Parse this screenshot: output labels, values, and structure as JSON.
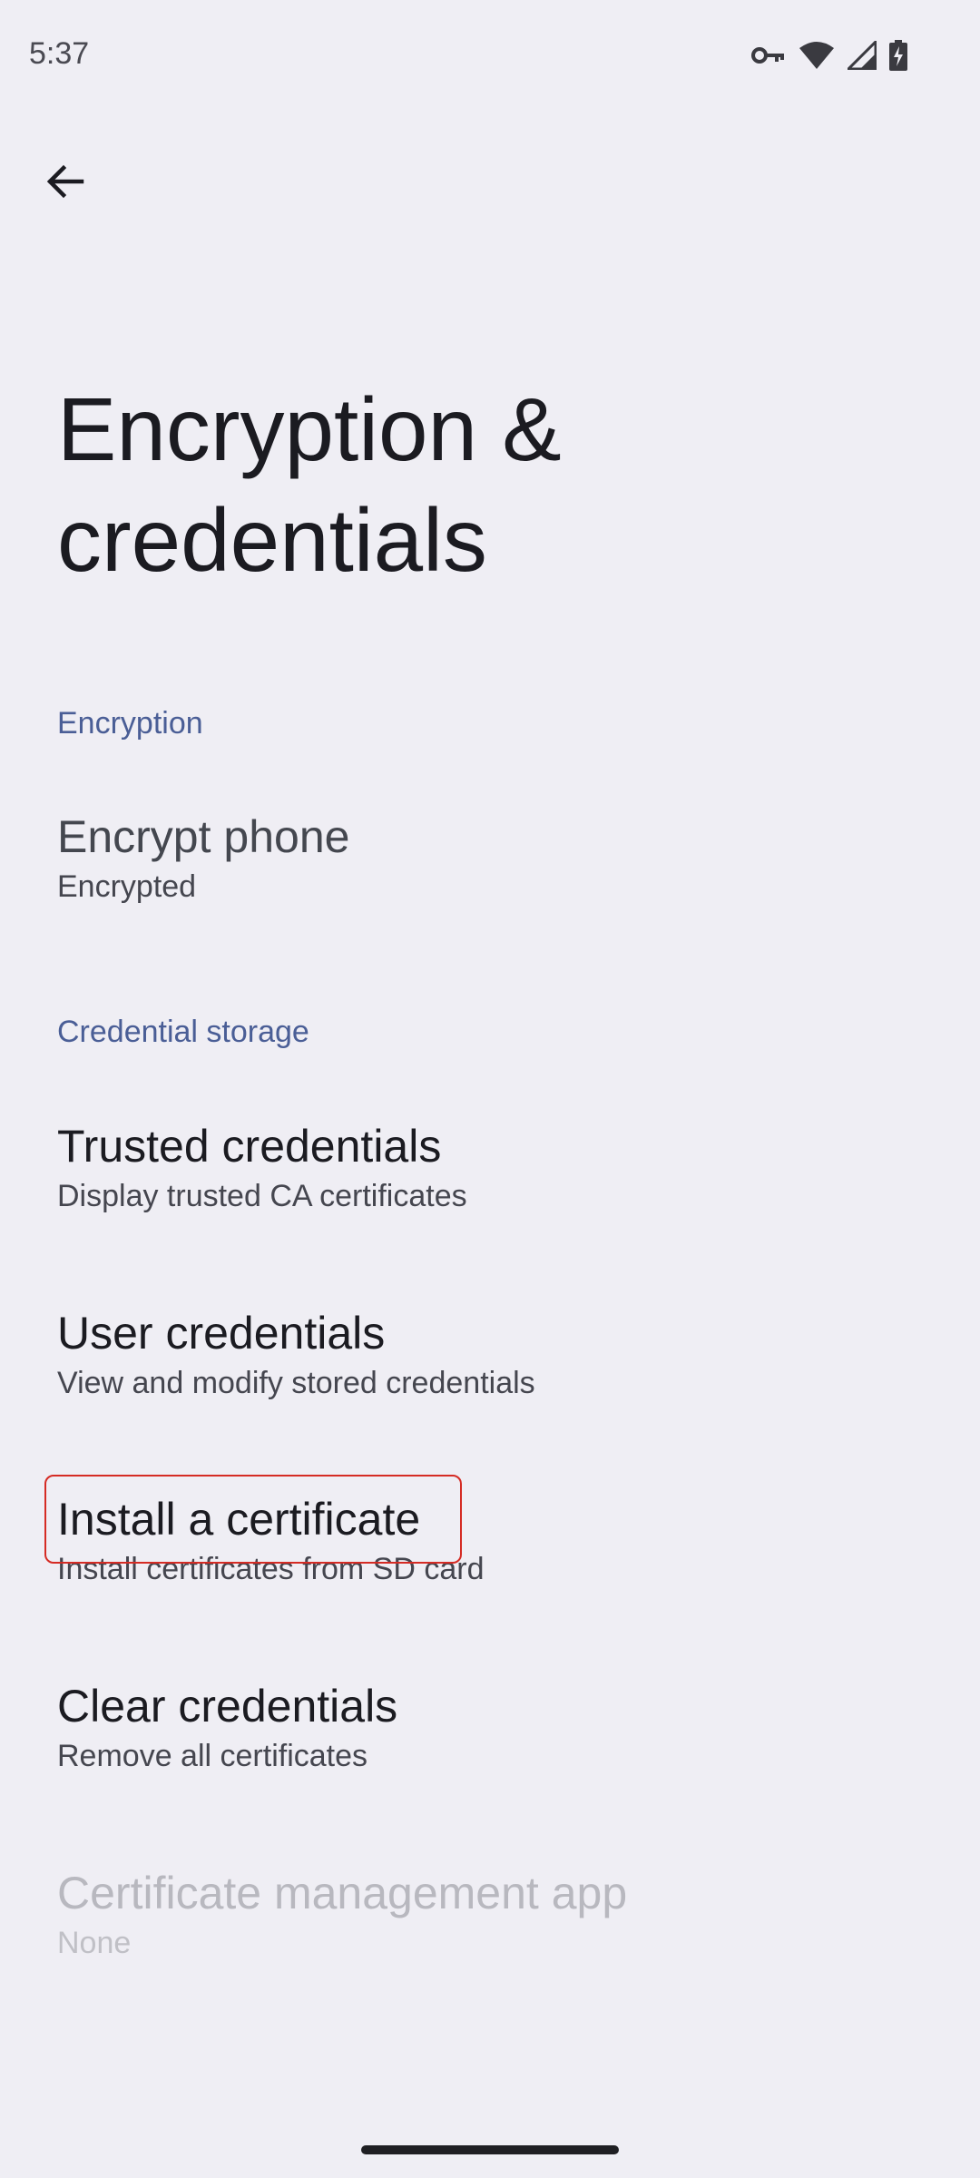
{
  "status_bar": {
    "time": "5:37"
  },
  "title": "Encryption & credentials",
  "sections": {
    "encryption": {
      "header": "Encryption",
      "encrypt_phone": {
        "title": "Encrypt phone",
        "summary": "Encrypted"
      }
    },
    "credential_storage": {
      "header": "Credential storage",
      "trusted": {
        "title": "Trusted credentials",
        "summary": "Display trusted CA certificates"
      },
      "user": {
        "title": "User credentials",
        "summary": "View and modify stored credentials"
      },
      "install": {
        "title": "Install a certificate",
        "summary": "Install certificates from SD card"
      },
      "clear": {
        "title": "Clear credentials",
        "summary": "Remove all certificates"
      },
      "cert_app": {
        "title": "Certificate management app",
        "summary": "None"
      }
    }
  },
  "colors": {
    "accent": "#4a5e96",
    "highlight": "#d52b24",
    "background": "#efeef4"
  }
}
